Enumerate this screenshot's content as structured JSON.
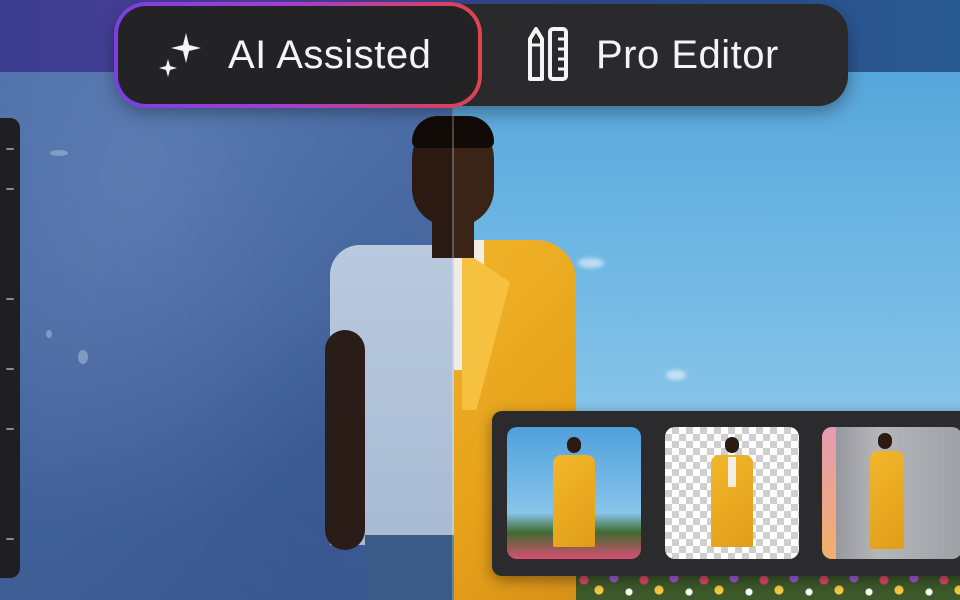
{
  "mode_switch": {
    "ai_label": "AI Assisted",
    "pro_label": "Pro Editor",
    "selected": "AI Assisted",
    "ai_icon": "sparkle-icon",
    "pro_icon": "pencil-ruler-icon",
    "selection_gradient": [
      "#7b3fe0",
      "#e0434f"
    ]
  },
  "variations": [
    {
      "background": "blue sky with flowers"
    },
    {
      "background": "transparent"
    },
    {
      "background": "concrete studio"
    }
  ],
  "colors": {
    "panel": "#2a2a2c",
    "jacket": "#f0b32a",
    "wall": "#4a6aa2",
    "sky": "#6db6e3"
  }
}
